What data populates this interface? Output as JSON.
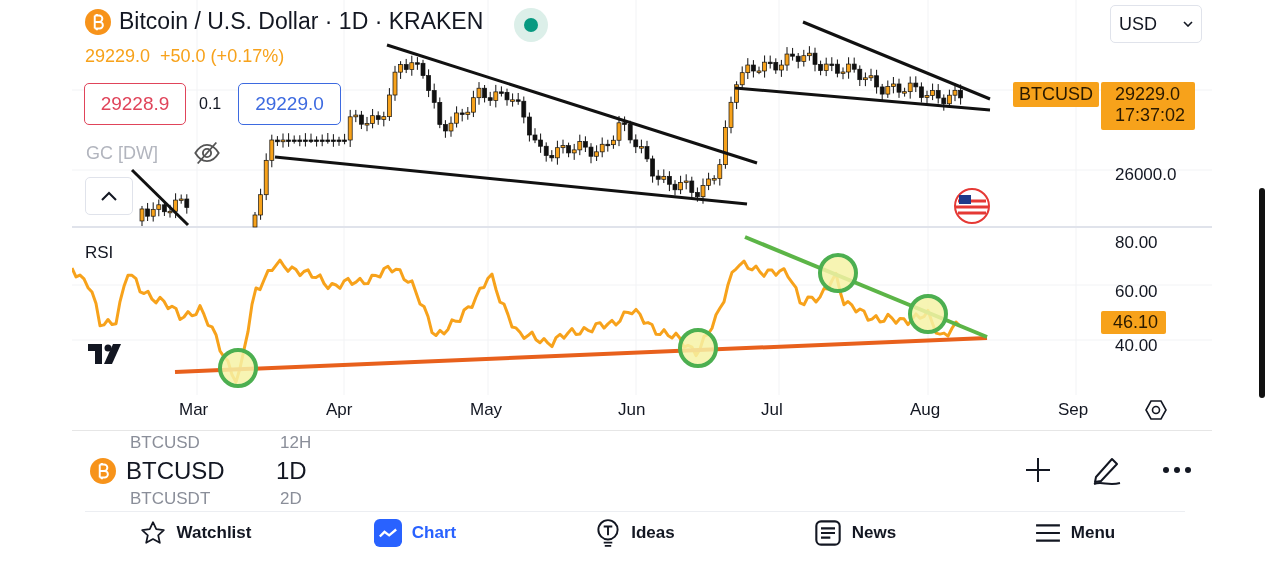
{
  "chart": {
    "title": "Bitcoin / U.S. Dollar · 1D · KRAKEN",
    "last_price": "29229.0",
    "change": "+50.0 (+0.17%)",
    "bid": "29228.9",
    "spread": "0.1",
    "ask": "29229.0",
    "indicator": "GC [DW]",
    "currency": "USD",
    "symbol_tag": "BTCUSD",
    "price_tag": "29229.0",
    "countdown": "17:37:02",
    "price_ticks": [
      "26000.0"
    ],
    "rsi": {
      "label": "RSI",
      "ticks": [
        "80.00",
        "60.00",
        "40.00"
      ],
      "value_tag": "46.10"
    },
    "time_labels": [
      "Mar",
      "Apr",
      "May",
      "Jun",
      "Jul",
      "Aug",
      "Sep"
    ]
  },
  "symbol_bar": {
    "previous": {
      "symbol": "BTCUSD",
      "interval": "12H"
    },
    "current": {
      "symbol": "BTCUSD",
      "interval": "1D"
    },
    "next": {
      "symbol": "BTCUSDT",
      "interval": "2D"
    }
  },
  "tabs": [
    {
      "label": "Watchlist",
      "kind": "star",
      "selected": false
    },
    {
      "label": "Chart",
      "kind": "chart",
      "selected": true
    },
    {
      "label": "Ideas",
      "kind": "bulb",
      "selected": false
    },
    {
      "label": "News",
      "kind": "news",
      "selected": false
    },
    {
      "label": "Menu",
      "kind": "menu",
      "selected": false
    }
  ]
}
